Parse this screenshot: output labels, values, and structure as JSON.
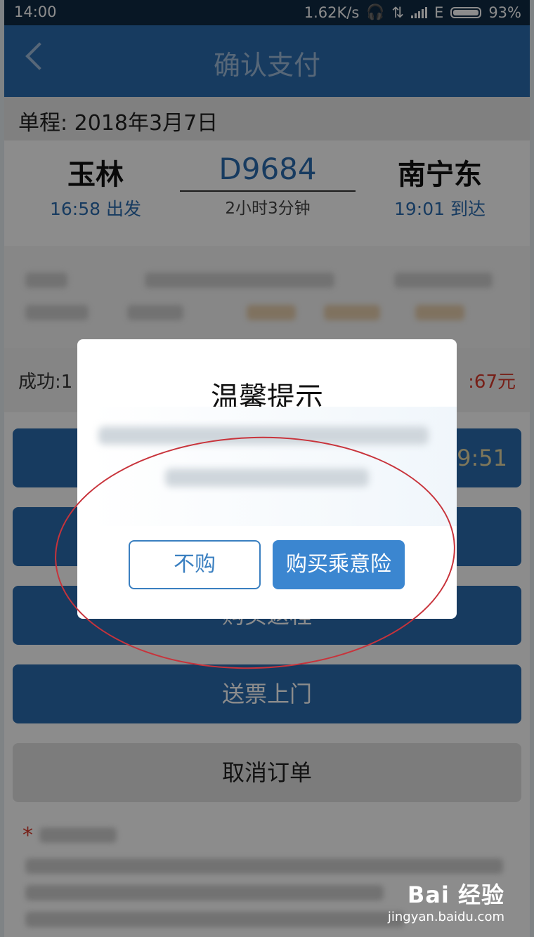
{
  "status_bar": {
    "time": "14:00",
    "net_speed": "1.62K/s",
    "network_type": "E",
    "battery": "93%"
  },
  "nav": {
    "title": "确认支付"
  },
  "trip": {
    "label": "单程: 2018年3月7日"
  },
  "train": {
    "from_station": "玉林",
    "depart_time": "16:58 出发",
    "number": "D9684",
    "duration": "2小时3分钟",
    "to_station": "南宁东",
    "arrive_time": "19:01 到达"
  },
  "payment": {
    "left_text": "成功:1",
    "right_text": ":67元"
  },
  "buttons": {
    "pay_timer": "9:51",
    "buy_return": "购买返程",
    "delivery": "送票上门",
    "cancel": "取消订单"
  },
  "dialog": {
    "title": "温馨提示",
    "btn_decline": "不购",
    "btn_accept": "购买乘意险"
  },
  "watermark": {
    "brand": "Bai 经验",
    "url": "jingyan.baidu.com"
  },
  "colors": {
    "primary": "#2b6cb0",
    "accent_red": "#d93a2b",
    "overlay": "rgba(0,0,0,0.45)"
  }
}
